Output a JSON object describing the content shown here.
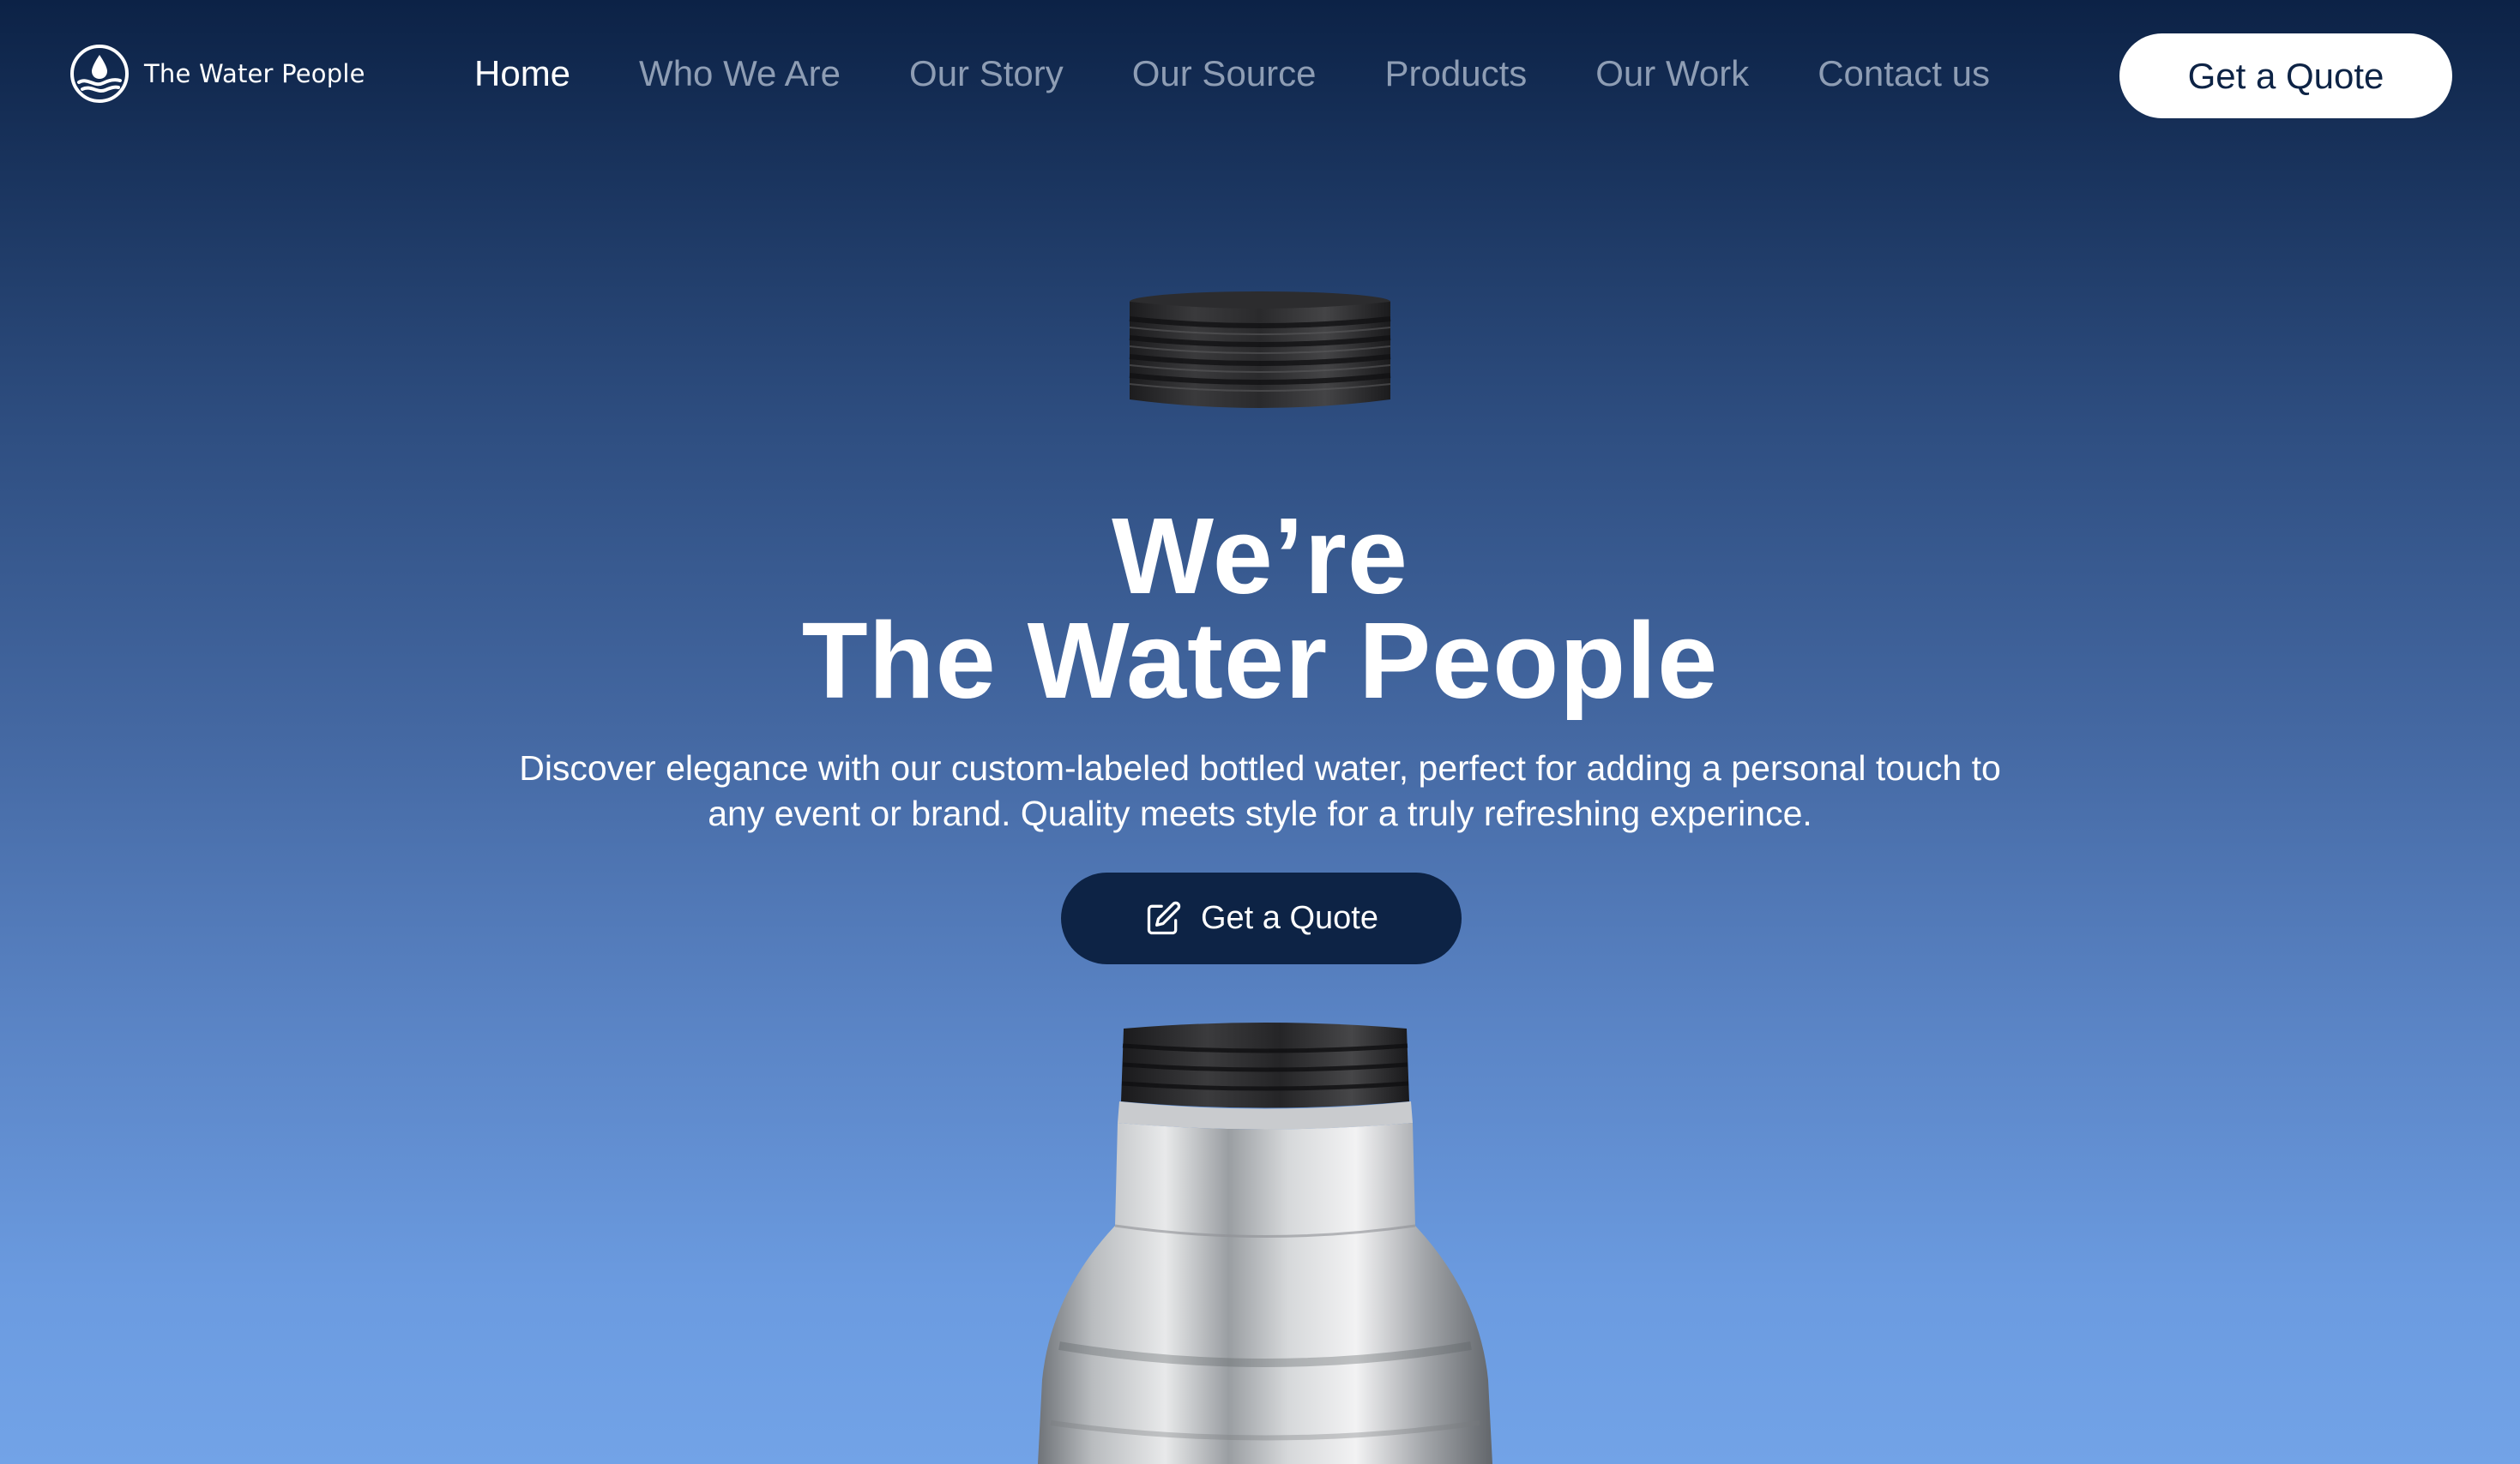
{
  "brand": {
    "name": "The Water People",
    "logo_icon": "water-drop-logo-icon"
  },
  "nav": {
    "items": [
      {
        "label": "Home",
        "active": true
      },
      {
        "label": "Who We Are",
        "active": false
      },
      {
        "label": "Our Story",
        "active": false
      },
      {
        "label": "Our Source",
        "active": false
      },
      {
        "label": "Products",
        "active": false
      },
      {
        "label": "Our Work",
        "active": false
      },
      {
        "label": "Contact us",
        "active": false
      }
    ],
    "cta_label": "Get a Quote"
  },
  "hero": {
    "headline_line1": "We’re",
    "headline_line2": "The Water People",
    "subtext": "Discover elegance with our custom-labeled bottled water, perfect for adding a personal touch to any event or brand. Quality meets style for a truly refreshing experince.",
    "cta_label": "Get a Quote",
    "cta_icon": "edit-icon"
  },
  "colors": {
    "gradient_top": "#0c2246",
    "gradient_bottom": "#72a3e7",
    "navy": "#0d2345",
    "nav_inactive": "#8e9db4",
    "white": "#ffffff"
  }
}
